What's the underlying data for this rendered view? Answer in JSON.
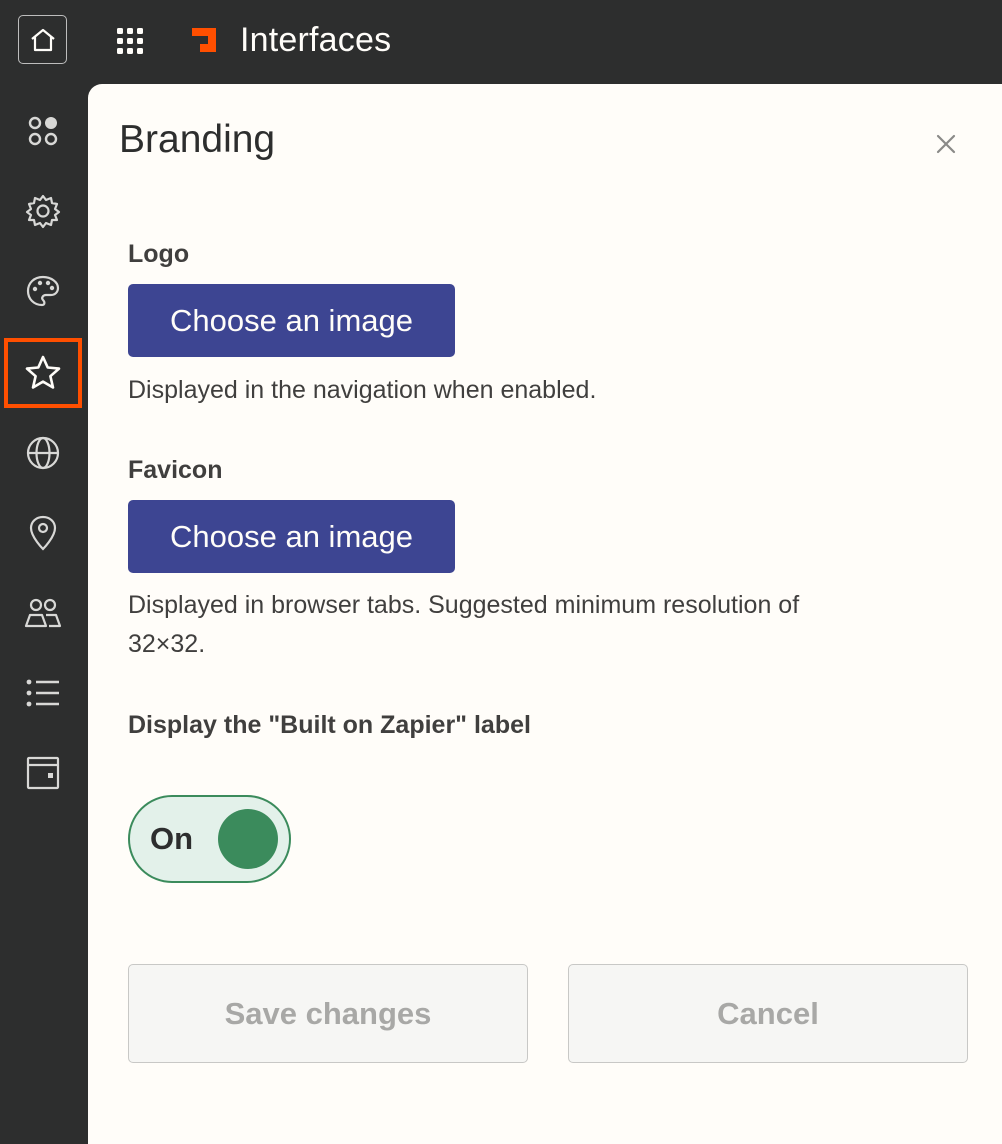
{
  "app": {
    "name": "Interfaces",
    "brand_color": "#ff4f00"
  },
  "topbar": {
    "home_icon": "home-icon",
    "apps_icon": "grid-icon"
  },
  "sidebar": {
    "active_index": 3,
    "items": [
      {
        "icon": "components-icon"
      },
      {
        "icon": "gear-icon"
      },
      {
        "icon": "palette-icon"
      },
      {
        "icon": "star-icon"
      },
      {
        "icon": "globe-icon"
      },
      {
        "icon": "location-pin-icon"
      },
      {
        "icon": "users-icon"
      },
      {
        "icon": "list-icon"
      },
      {
        "icon": "wallet-icon"
      }
    ]
  },
  "panel": {
    "title": "Branding",
    "close_icon": "close-icon",
    "logo": {
      "label": "Logo",
      "button": "Choose an image",
      "help": "Displayed in the navigation when enabled."
    },
    "favicon": {
      "label": "Favicon",
      "button": "Choose an image",
      "help_line1": "Displayed in browser tabs. Suggested minimum resolution of",
      "help_line2": "32×32."
    },
    "built_on": {
      "label": "Display the \"Built on Zapier\" label",
      "toggle_text": "On",
      "toggle_on": true
    },
    "footer": {
      "save": "Save changes",
      "cancel": "Cancel"
    }
  },
  "colors": {
    "chrome_bg": "#2d2e2e",
    "panel_bg": "#fffdf9",
    "primary_button": "#3d4592",
    "toggle_green": "#3b8b5c",
    "toggle_bg": "#e3f1ea"
  }
}
